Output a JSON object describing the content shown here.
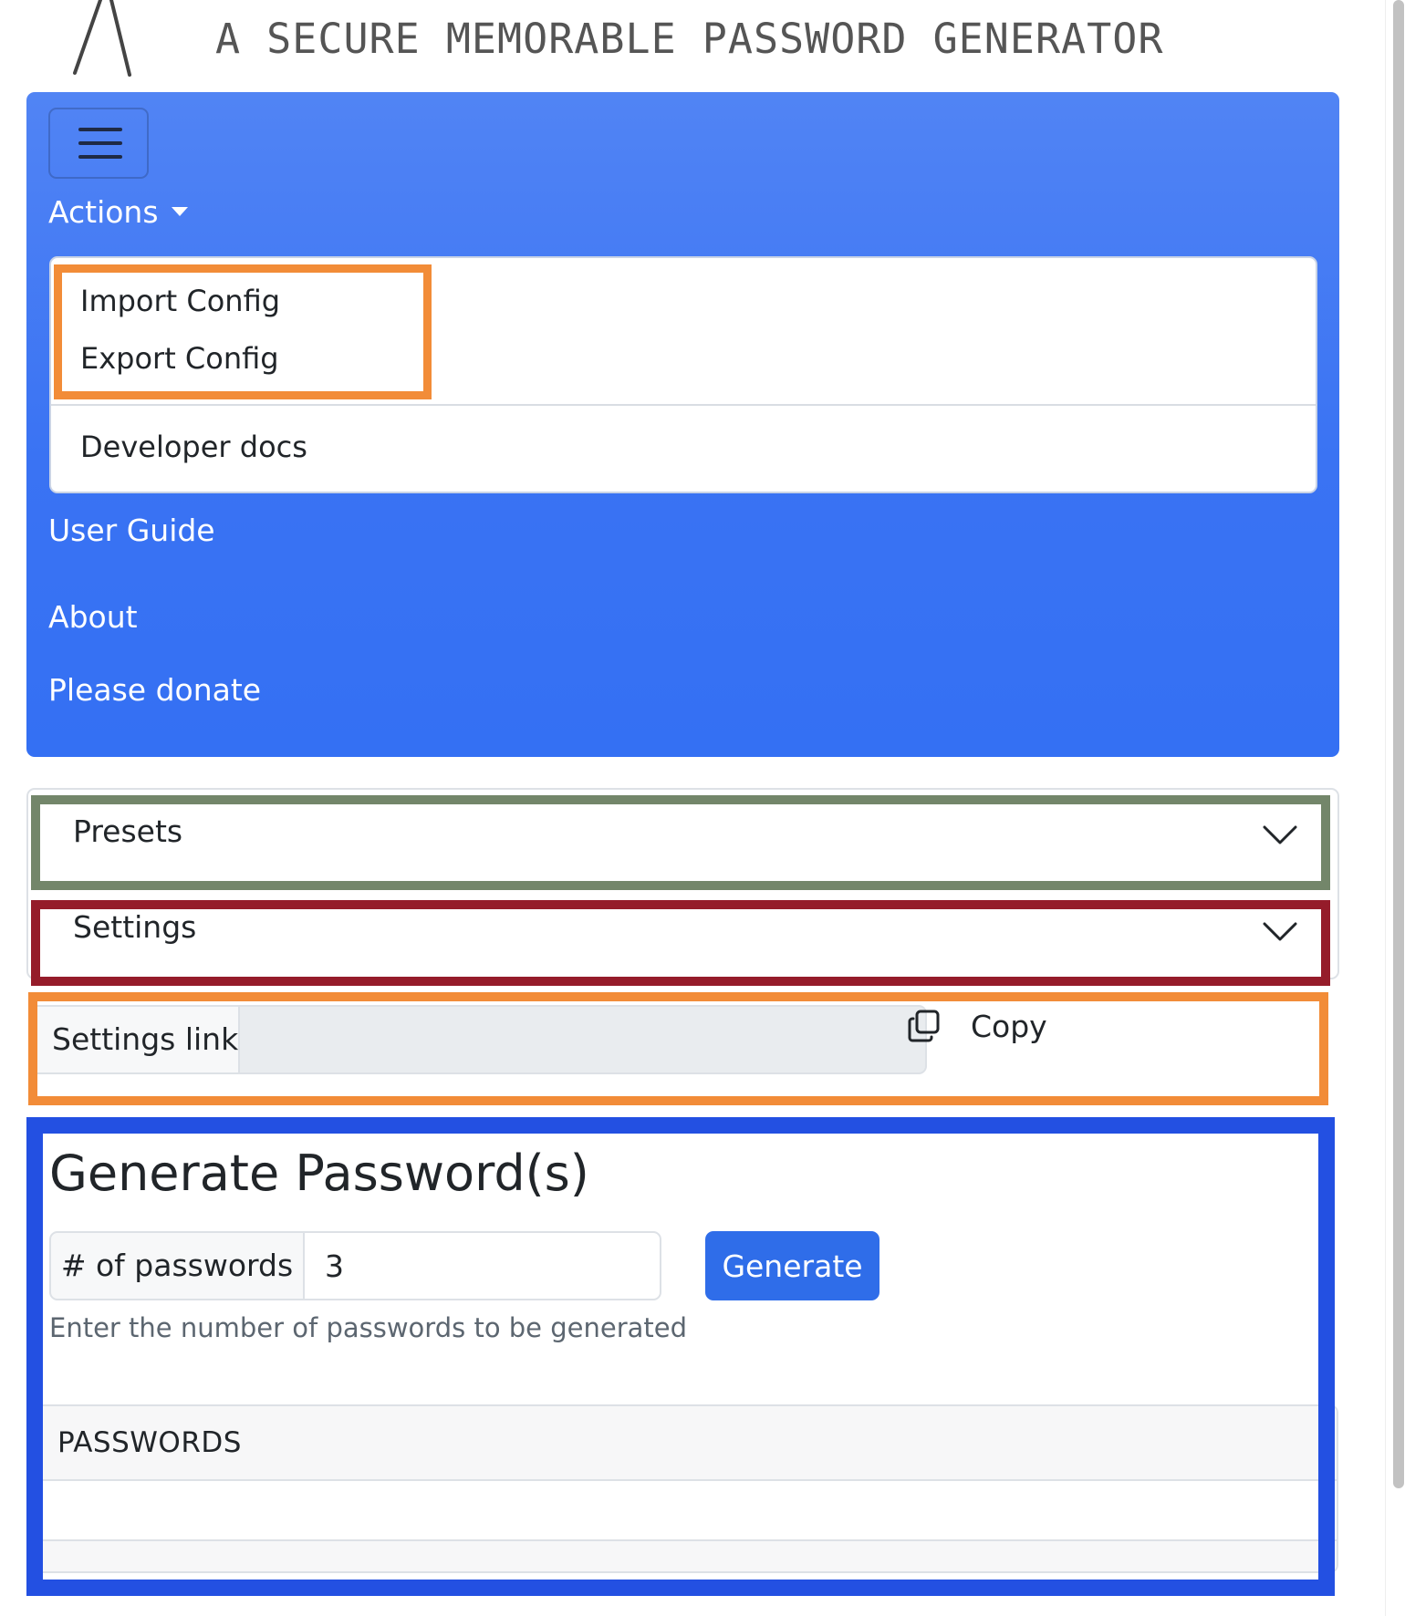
{
  "header": {
    "tagline": "A SECURE MEMORABLE PASSWORD GENERATOR"
  },
  "navbar": {
    "toggler_icon": "hamburger-icon",
    "actions_label": "Actions",
    "dropdown_items": [
      {
        "label": "Import Config"
      },
      {
        "label": "Export Config"
      },
      {
        "label": "Developer docs"
      }
    ],
    "links": [
      {
        "label": "User Guide"
      },
      {
        "label": "About"
      },
      {
        "label": "Please donate"
      }
    ],
    "gradient_top": "#5184f4",
    "gradient_bottom": "#3470f3"
  },
  "accordion": {
    "presets_label": "Presets",
    "settings_label": "Settings",
    "chevron_icon": "chevron-down-icon"
  },
  "settings_link": {
    "label": "Settings link",
    "value": "",
    "copy_label": "Copy",
    "copy_icon": "copy-icon"
  },
  "generate": {
    "title": "Generate Password(s)",
    "num_label": "# of passwords",
    "num_value": "3",
    "button_label": "Generate",
    "help_text": "Enter the number of passwords to be generated",
    "table_header": "PASSWORDS"
  },
  "colors": {
    "primary": "#2f6de9",
    "highlight_orange": "#f28c38",
    "highlight_green": "#73866a",
    "highlight_red": "#951c2a",
    "highlight_blue": "#2350e2"
  }
}
